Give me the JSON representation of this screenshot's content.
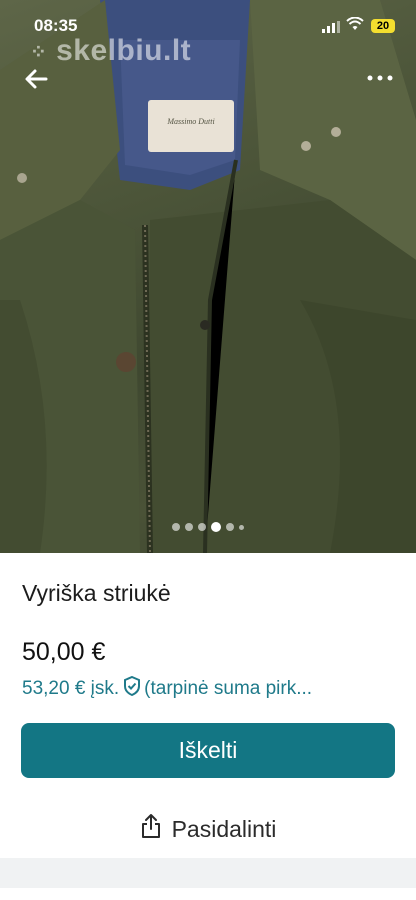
{
  "status_bar": {
    "time": "08:35",
    "battery": "20"
  },
  "gallery": {
    "watermark": "skelbiu.lt",
    "image_description_icon": "photo-jacket",
    "dots_total": 6,
    "active_index": 3
  },
  "listing": {
    "title": "Vyriška striukė",
    "price": "50,00 €",
    "buyer_price": "53,20 € įsk.",
    "buyer_price_note": "(tarpinė suma pirk..."
  },
  "actions": {
    "promote_label": "Iškelti",
    "share_label": "Pasidalinti"
  },
  "colors": {
    "accent": "#137684",
    "link": "#1f7a8a",
    "battery": "#f4de2f"
  }
}
